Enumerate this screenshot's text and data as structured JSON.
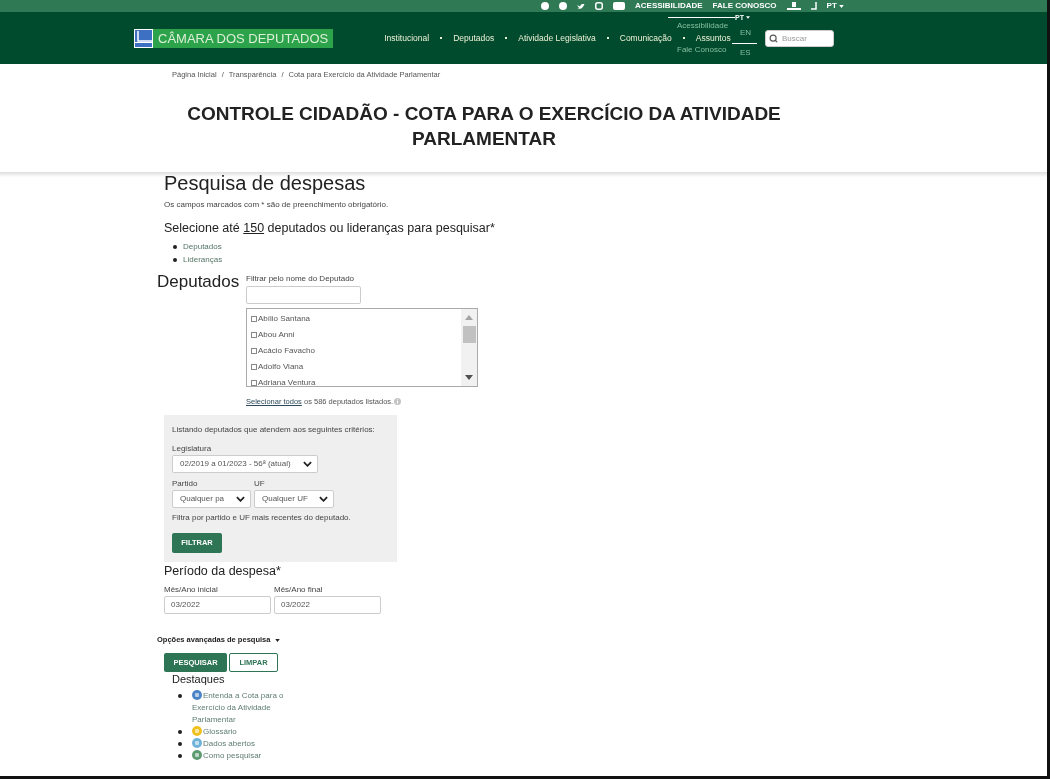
{
  "top_bar": {
    "links": [
      "ACESSIBILIDADE",
      "FALE CONOSCO"
    ],
    "language": "PT"
  },
  "header": {
    "logo_text": "CÂMARA DOS DEPUTADOS",
    "nav": [
      "Institucional",
      "Deputados",
      "Atividade Legislativa",
      "Comunicação",
      "Assuntos"
    ],
    "search": {
      "placeholder": "Buscar"
    }
  },
  "language_menu": {
    "current": "PT",
    "links": [
      "Acessibilidade",
      "Fale Conosco"
    ],
    "options": [
      "EN",
      "ES"
    ]
  },
  "breadcrumb": {
    "items": [
      "Página Inicial",
      "Transparência",
      "Cota para Exercício da Atividade Parlamentar"
    ],
    "separator": "/"
  },
  "page_title": "CONTROLE CIDADÃO - COTA PARA O EXERCÍCIO DA ATIVIDADE PARLAMENTAR",
  "search_form": {
    "title": "Pesquisa de despesas",
    "required_note": "Os campos marcados com * são de preenchimento obrigatório.",
    "select_prompt": {
      "before": "Selecione até ",
      "limit": "150",
      "after": " deputados ou lideranças para pesquisar*"
    },
    "select_links": [
      "Deputados",
      "Lideranças"
    ],
    "deputados": {
      "heading": "Deputados",
      "filter_label": "Filtrar pelo nome do Deputado",
      "list": [
        {
          "name": "Abílio Santana",
          "checked": false
        },
        {
          "name": "Abou Anni",
          "checked": false
        },
        {
          "name": "Acácio Favacho",
          "checked": false
        },
        {
          "name": "Adolfo Viana",
          "checked": false
        },
        {
          "name": "Adriana Ventura",
          "checked": false
        }
      ],
      "select_all": {
        "link": "Selecionar todos",
        "text": " os 586 deputados listados."
      }
    },
    "criteria": {
      "intro": "Listando deputados que atendem aos seguintes critérios:",
      "legislatura": {
        "label": "Legislatura",
        "value": "02/2019 a 01/2023 - 56ª (atual)"
      },
      "partido": {
        "label": "Partido",
        "value": "Qualquer pa"
      },
      "uf": {
        "label": "UF",
        "value": "Qualquer UF"
      },
      "note": "Filtra por partido e UF mais recentes do deputado.",
      "button": "FILTRAR"
    },
    "period": {
      "title": "Período da despesa*",
      "start": {
        "label": "Mês/Ano inicial",
        "value": "03/2022"
      },
      "end": {
        "label": "Mês/Ano final",
        "value": "03/2022"
      }
    },
    "advanced": {
      "label": "Opções avançadas de pesquisa",
      "expanded": false
    },
    "buttons": [
      {
        "label": "PESQUISAR",
        "kind": "primary"
      },
      {
        "label": "LIMPAR",
        "kind": "outline"
      }
    ]
  },
  "highlights": {
    "title": "Destaques",
    "items": [
      {
        "label": "Entenda a Cota para o Exercício da Atividade Parlamentar",
        "color": "#4a84c6"
      },
      {
        "label": "Glossário",
        "color": "#f0c020"
      },
      {
        "label": "Dados abertos",
        "color": "#6fb4d8"
      },
      {
        "label": "Como pesquisar",
        "color": "#5c9a72"
      }
    ]
  }
}
